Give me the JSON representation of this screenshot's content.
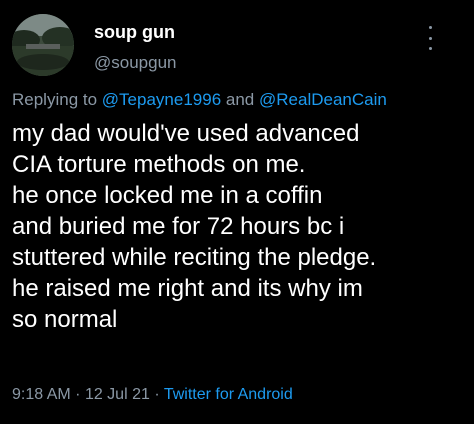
{
  "author": {
    "display_name": "soup gun",
    "handle": "@soupgun"
  },
  "reply": {
    "prefix": "Replying to",
    "mention_1": "@Tepayne1996",
    "conjunction": "and",
    "mention_2": "@RealDeanCain"
  },
  "tweet": {
    "lines": [
      "my dad would've used advanced",
      "CIA torture methods on me.",
      "he once locked me in a coffin",
      "and buried me for 72 hours bc i",
      "stuttered while reciting the pledge.",
      "he raised me right and its why im",
      "so normal"
    ]
  },
  "meta": {
    "time": "9:18 AM",
    "separator": "·",
    "date": "12 Jul 21",
    "source": "Twitter for Android"
  },
  "colors": {
    "background": "#000000",
    "text": "#ffffff",
    "secondary": "#8b98a5",
    "link": "#1d9bf0"
  },
  "icons": {
    "more": "more-vertical-icon"
  }
}
